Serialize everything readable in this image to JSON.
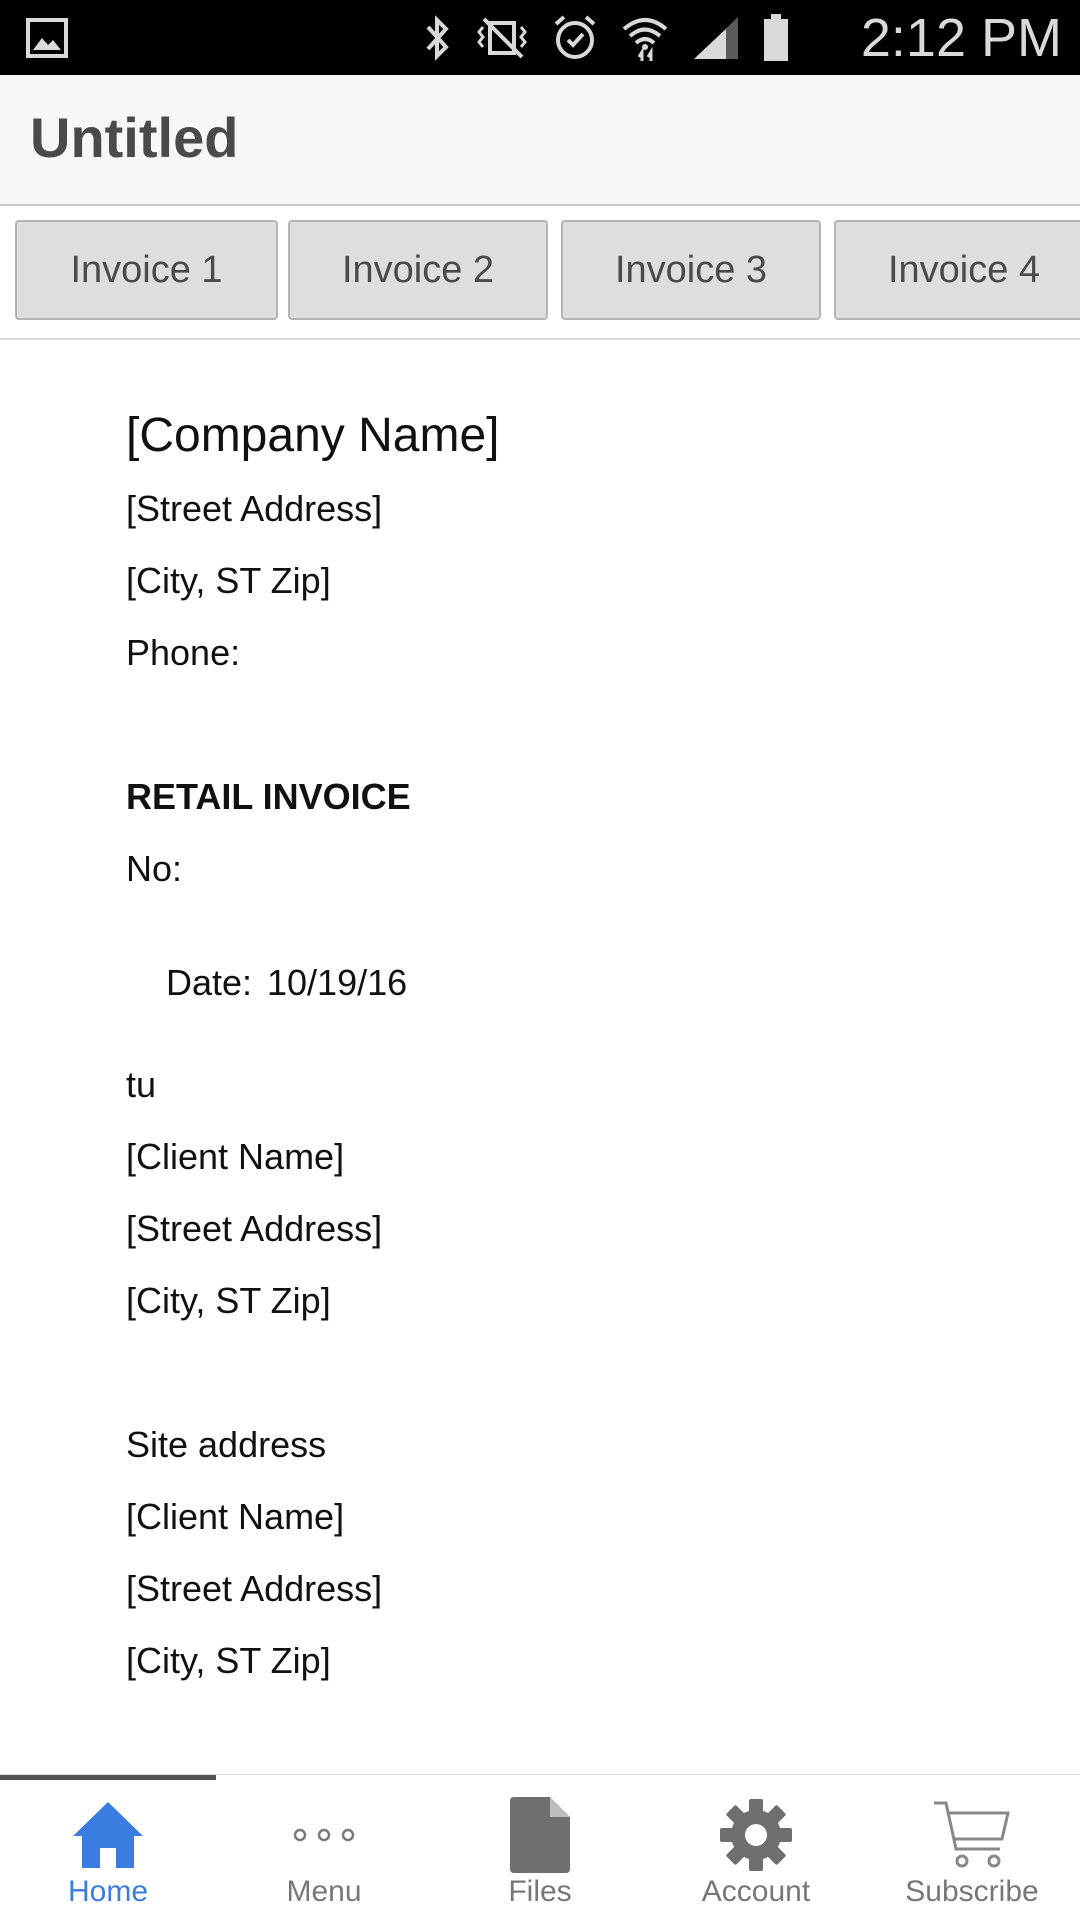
{
  "status_bar": {
    "time": "2:12 PM",
    "icons": [
      "gallery-icon",
      "bluetooth-icon",
      "vibrate-mute-icon",
      "alarm-icon",
      "wifi-icon",
      "signal-icon",
      "battery-icon"
    ]
  },
  "app": {
    "title": "Untitled"
  },
  "tabs": [
    {
      "label": "Invoice 1"
    },
    {
      "label": "Invoice 2"
    },
    {
      "label": "Invoice 3"
    },
    {
      "label": "Invoice 4"
    }
  ],
  "document": {
    "company_name": "[Company Name]",
    "company_street": "[Street Address]",
    "company_city": "[City, ST Zip]",
    "phone_label": "Phone:",
    "heading": "RETAIL INVOICE",
    "no_label": "No:",
    "date_label": "Date:",
    "date_value": "10/19/16",
    "to_label": "tu",
    "client_name": "[Client Name]",
    "client_street": "[Street Address]",
    "client_city": "[City, ST Zip]",
    "site_label": "Site address",
    "site_client_name": "[Client Name]",
    "site_street": "[Street Address]",
    "site_city": "[City, ST Zip]"
  },
  "bottom_nav": {
    "active": "home",
    "accent_color": "#3b7ce0",
    "items": [
      {
        "label": "Home",
        "icon": "home-icon"
      },
      {
        "label": "Menu",
        "icon": "more-dots-icon"
      },
      {
        "label": "Files",
        "icon": "file-icon"
      },
      {
        "label": "Account",
        "icon": "gear-icon"
      },
      {
        "label": "Subscribe",
        "icon": "cart-icon"
      }
    ]
  }
}
